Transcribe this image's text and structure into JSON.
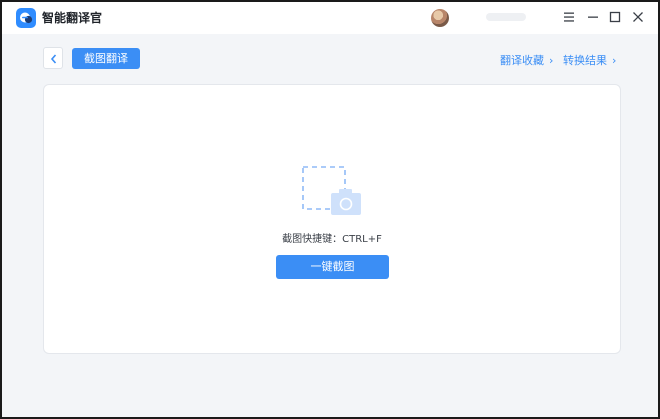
{
  "app": {
    "title": "智能翻译官"
  },
  "titlebar": {
    "icons": [
      "app-logo",
      "avatar",
      "menu-icon",
      "minimize-icon",
      "maximize-icon",
      "close-icon"
    ]
  },
  "toolbar": {
    "back_icon": "chevron-left-icon",
    "active_tab": "截图翻译",
    "links": [
      {
        "label": "翻译收藏",
        "icon": "chevron-right-icon"
      },
      {
        "label": "转换结果",
        "icon": "chevron-right-icon"
      }
    ]
  },
  "main": {
    "illustration_icon": "screenshot-camera-icon",
    "shortcut_hint": "截图快捷键：CTRL+F",
    "capture_button": "一键截图"
  },
  "colors": {
    "accent": "#3b8ef5",
    "background": "#f3f5f8",
    "panel": "#ffffff"
  }
}
